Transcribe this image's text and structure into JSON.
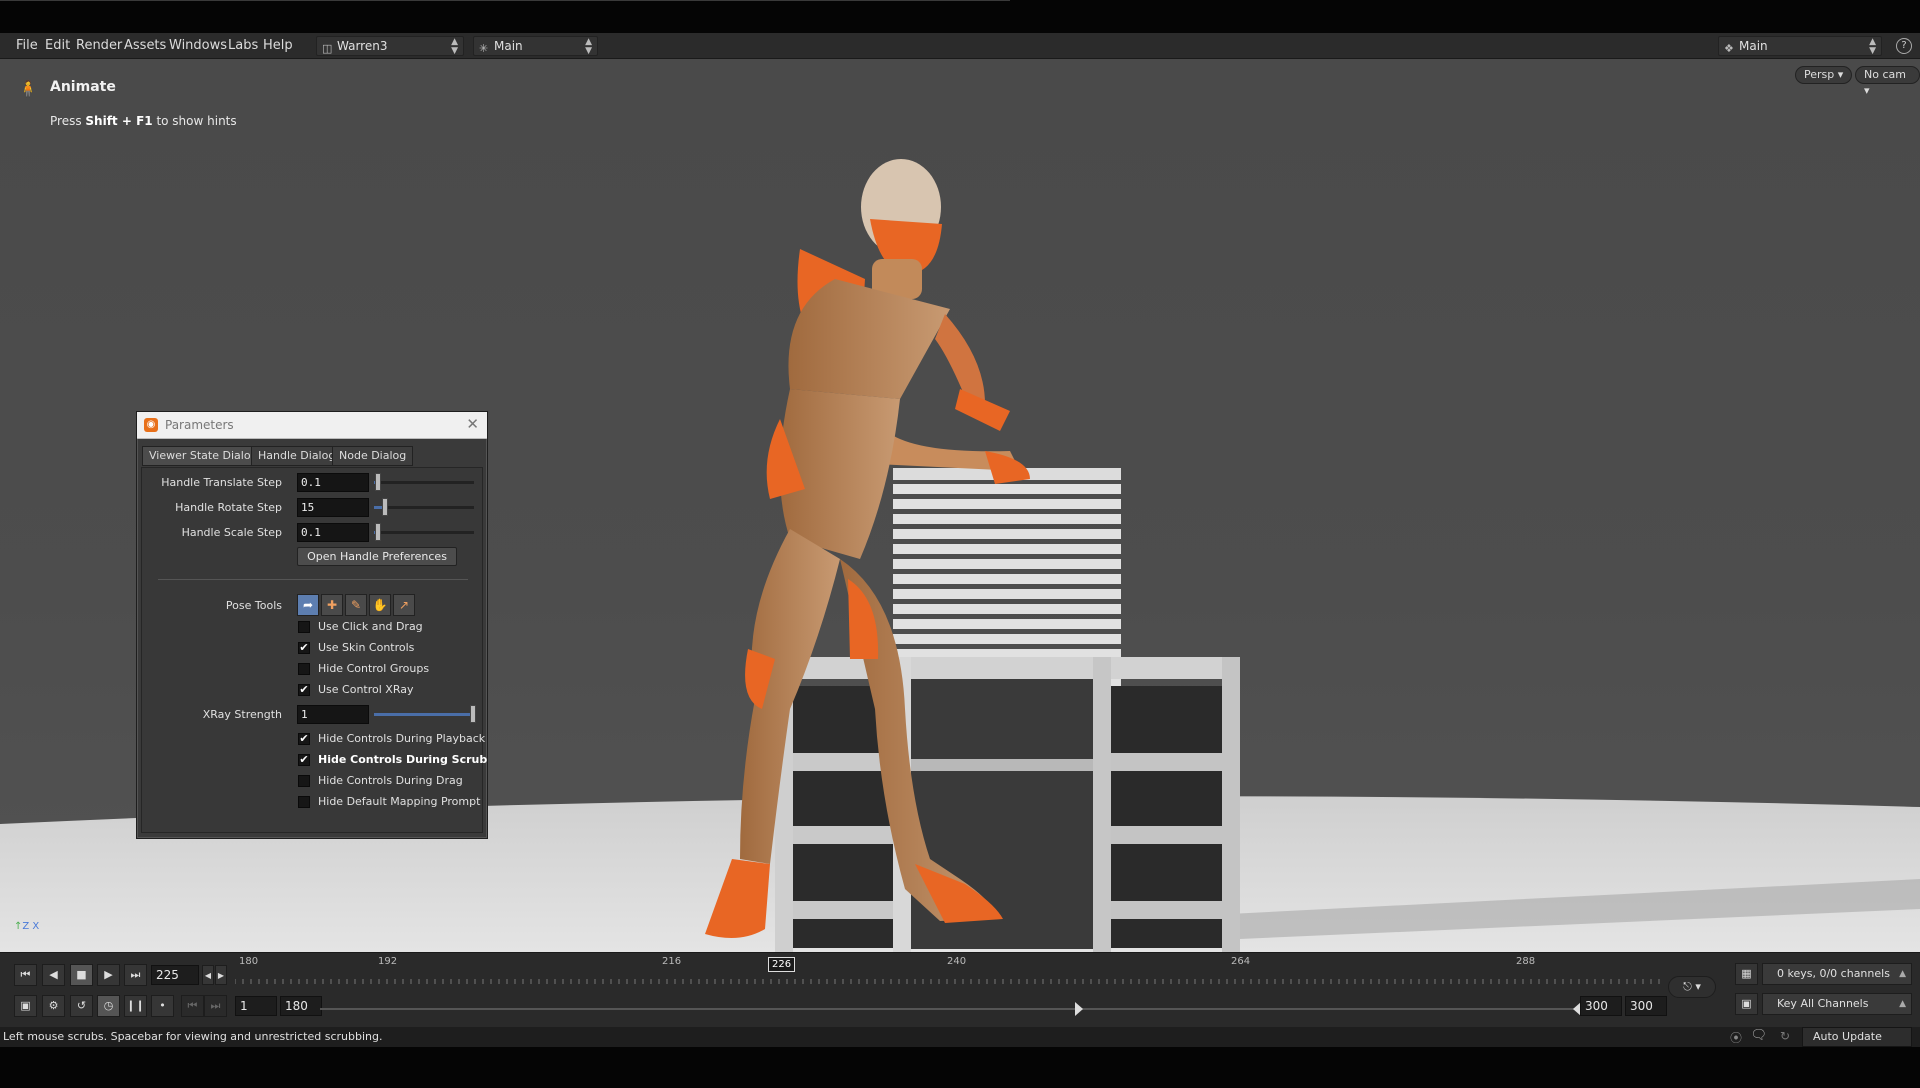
{
  "menubar": {
    "items": [
      "File",
      "Edit",
      "Render",
      "Assets",
      "Windows",
      "Labs",
      "Help"
    ],
    "desktop": "Warren3",
    "network": "Main",
    "right_combo": "Main",
    "help_icon": "?"
  },
  "viewport": {
    "state_title": "Animate",
    "hint_prefix": "Press ",
    "hint_keys": "Shift + F1",
    "hint_suffix": " to show hints",
    "persp_label": "Persp ▾",
    "cam_label": "No cam ▾",
    "axis_label": "Z X"
  },
  "parameters": {
    "title": "Parameters",
    "tabs": [
      "Viewer State Dialog",
      "Handle Dialog",
      "Node Dialog"
    ],
    "fields": [
      {
        "label": "Handle Translate Step",
        "value": "0.1",
        "slider": 0.05
      },
      {
        "label": "Handle Rotate Step",
        "value": "15",
        "slider": 0.12
      },
      {
        "label": "Handle Scale Step",
        "value": "0.1",
        "slider": 0.05
      }
    ],
    "open_prefs_label": "Open Handle Preferences",
    "pose_tools_label": "Pose Tools",
    "checkboxes_a": [
      {
        "label": "Use Click and Drag",
        "checked": false
      },
      {
        "label": "Use Skin Controls",
        "checked": true
      },
      {
        "label": "Hide Control Groups",
        "checked": false
      },
      {
        "label": "Use Control XRay",
        "checked": true
      }
    ],
    "xray_label": "XRay Strength",
    "xray_value": "1",
    "xray_slider": 1.0,
    "checkboxes_b": [
      {
        "label": "Hide Controls During Playback",
        "checked": true
      },
      {
        "label": "Hide Controls During Scrub",
        "checked": true
      },
      {
        "label": "Hide Controls During Drag",
        "checked": false
      },
      {
        "label": "Hide Default Mapping Prompt",
        "checked": false
      }
    ]
  },
  "timeline": {
    "current_frame": "225",
    "cursor_frame": "226",
    "ticks": [
      "180",
      "192",
      "216",
      "240",
      "264",
      "288"
    ],
    "range_start": "1",
    "range_mid": "180",
    "range_end_a": "300",
    "range_end_b": "300",
    "keys_info": "0 keys, 0/0 channels",
    "key_all": "Key All Channels"
  },
  "status": {
    "text": "Left mouse scrubs. Spacebar for viewing and unrestricted scrubbing.",
    "auto_update": "Auto Update"
  },
  "colors": {
    "accent": "#e8701a",
    "selection_blue": "#5d7eb0"
  }
}
